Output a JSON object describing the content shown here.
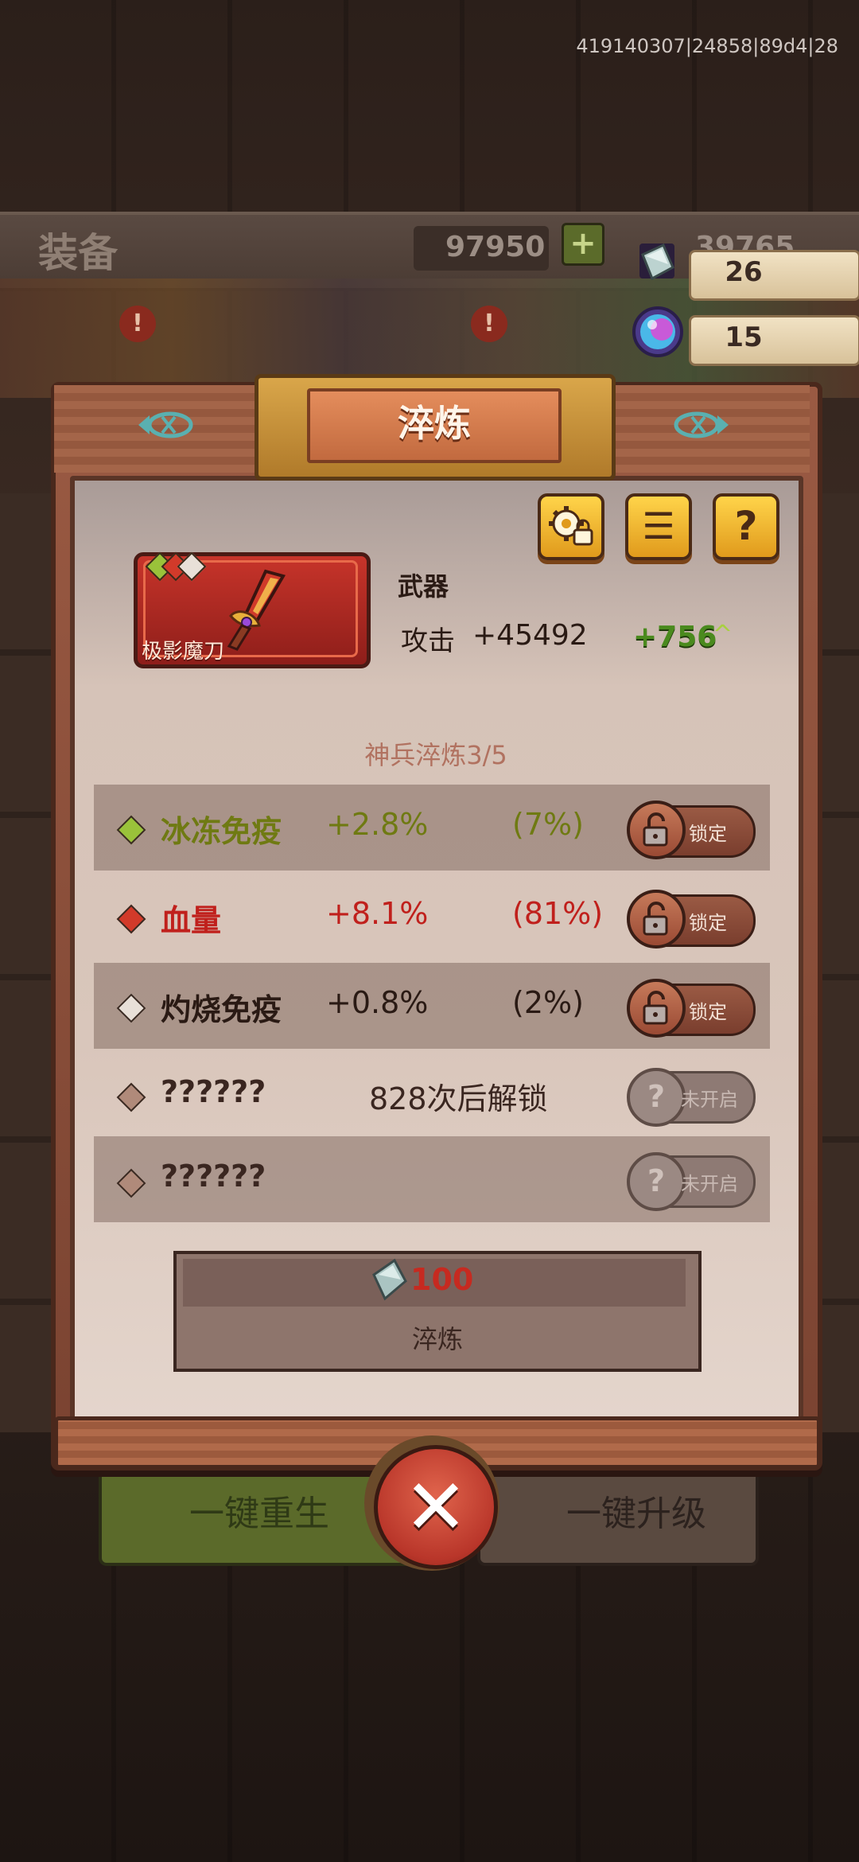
{
  "debug_id": "419140307|24858|89d4|28",
  "background": {
    "screen_title": "装备",
    "resource_left": "97950",
    "resource_right": "39765",
    "alert_mark": "!",
    "plus_mark": "+",
    "bottom_left_button": "一键重生",
    "bottom_right_button": "一键升级"
  },
  "currency": {
    "crystal_count": "26",
    "gem_count": "15"
  },
  "modal": {
    "title": "淬炼",
    "item": {
      "name": "极影魔刀",
      "type": "武器",
      "stat_name": "攻击",
      "stat_value": "+45492",
      "stat_bonus": "+756",
      "stat_bonus_arrow": "^"
    },
    "refine_progress": "神兵淬炼3/5",
    "attributes": [
      {
        "name": "冰冻免疫",
        "value": "+2.8%",
        "percent": "(7%)",
        "button": "锁定",
        "color": "#6f7a12",
        "gem_color": "#9ac23a"
      },
      {
        "name": "血量",
        "value": "+8.1%",
        "percent": "(81%)",
        "button": "锁定",
        "color": "#c0201c",
        "gem_color": "#d23a2a"
      },
      {
        "name": "灼烧免疫",
        "value": "+0.8%",
        "percent": "(2%)",
        "button": "锁定",
        "color": "#2a1a14",
        "gem_color": "#e8e0d8"
      },
      {
        "name": "??????",
        "unlock_text": "828次后解锁",
        "button": "未开启",
        "icon_text": "?",
        "color": "#3a2620",
        "gem_color": "#b08a7a"
      },
      {
        "name": "??????",
        "button": "未开启",
        "icon_text": "?",
        "color": "#3a2620",
        "gem_color": "#b08a7a"
      }
    ],
    "refine_button": {
      "cost": "100",
      "label": "淬炼"
    },
    "toolbar": {
      "settings_icon": "gear-lock-icon",
      "menu_glyph": "☰",
      "help_glyph": "?"
    },
    "close_glyph": "✕"
  }
}
